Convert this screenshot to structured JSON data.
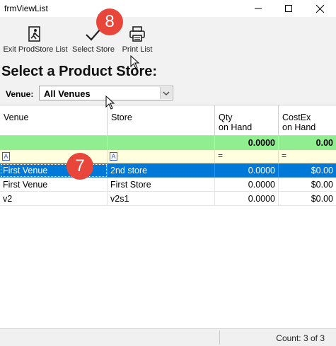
{
  "window": {
    "title": "frmViewList"
  },
  "toolbar": {
    "exit_label": "Exit ProdStore List",
    "select_label": "Select Store",
    "print_label": "Print List"
  },
  "heading": "Select a Product Store:",
  "venue_filter": {
    "label": "Venue:",
    "value": "All Venues"
  },
  "grid": {
    "columns": [
      "Venue",
      "Store",
      "Qty\non Hand",
      "CostEx\non Hand"
    ],
    "totals": {
      "qty": "0.0000",
      "cost": "0.00"
    },
    "filter": {
      "venue_icon": "A",
      "store_icon": "A",
      "qty_op": "=",
      "cost_op": "="
    },
    "rows": [
      {
        "venue": "First Venue",
        "store": "2nd store",
        "qty": "0.0000",
        "cost": "$0.00",
        "selected": true
      },
      {
        "venue": "First Venue",
        "store": "First Store",
        "qty": "0.0000",
        "cost": "$0.00",
        "selected": false
      },
      {
        "venue": "v2",
        "store": "v2s1",
        "qty": "0.0000",
        "cost": "$0.00",
        "selected": false
      }
    ]
  },
  "status": {
    "count": "Count: 3 of 3"
  },
  "badges": {
    "toolbar_step": "8",
    "row_step": "7"
  },
  "colors": {
    "selection": "#0078d7",
    "totals_row": "#90ee90",
    "filter_row": "#ffffe0",
    "badge": "#e8463a"
  }
}
